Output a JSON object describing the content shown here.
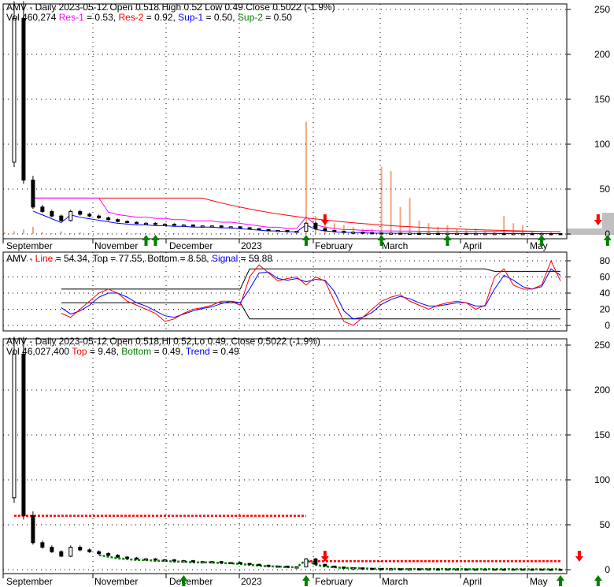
{
  "ticker": "AMV",
  "panel1": {
    "title": "AMV - Daily 2023-05-12 Open 0.518  High 0.52  Low 0.49  Close 0.5022 (-1.9%)",
    "vol": "Vol 460,274 ",
    "res1": "Res-1",
    "res1_val": " = 0.53, ",
    "res2": "Res-2",
    "res2_val": " = 0.92, ",
    "sup1": "Sup-1",
    "sup1_val": " = 0.50, ",
    "sup2": "Sup-2",
    "sup2_val": " = 0.50"
  },
  "panel2": {
    "prefix": "AMV - ",
    "line": "Line",
    "line_val": " = 54.34, Top = 77.55, Bottom = 8.58, ",
    "signal": "Signal",
    "signal_val": " = 59.88"
  },
  "panel3": {
    "title": "AMV - Daily 2023-05-12 Open 0.518,Hi 0.52,Lo 0.49, Close 0.5022 (-1.9%)",
    "vol": "Vol 46,027,400 ",
    "top": "Top",
    "top_val": " = 9.48, ",
    "bottom": "Bottom",
    "bottom_val": " = 0.49, ",
    "trend": "Trend",
    "trend_val": " = 0.49"
  },
  "colors": {
    "res1": "#ff00ff",
    "res2": "#ff0000",
    "sup1": "#0000ff",
    "sup2": "#008000",
    "volume": "#f4a582",
    "up": "#008000",
    "down": "#ff0000"
  },
  "chart_data": [
    {
      "type": "candlestick",
      "title": "AMV - Daily",
      "yticks": [
        0,
        50,
        100,
        150,
        200,
        250
      ],
      "ylim": [
        0,
        260
      ],
      "xlabels": [
        "September",
        "November",
        "December",
        "2023",
        "February",
        "March",
        "April",
        "May"
      ],
      "close": [
        80,
        240,
        60,
        30,
        25,
        20,
        15,
        25,
        22,
        20,
        18,
        16,
        14,
        13,
        12,
        12,
        11,
        11,
        10,
        10,
        9,
        9,
        9,
        8,
        8,
        7,
        6,
        5,
        4,
        4,
        3,
        3,
        12,
        6,
        4,
        3,
        2,
        2,
        1.5,
        1.2,
        1,
        1,
        0.9,
        0.9,
        0.8,
        0.8,
        0.7,
        0.7,
        0.7,
        0.6,
        0.6,
        0.6,
        0.6,
        0.55,
        0.55,
        0.55,
        0.52,
        0.52,
        0.51,
        0.5
      ],
      "volume": [
        2,
        3,
        5,
        8,
        2,
        1,
        3,
        1,
        2,
        1,
        1,
        1,
        0,
        2,
        1,
        1,
        0,
        1,
        1,
        0,
        1,
        1,
        0,
        1,
        1,
        0,
        1,
        1,
        2,
        1,
        3,
        2,
        125,
        20,
        15,
        12,
        10,
        8,
        6,
        6,
        75,
        70,
        30,
        40,
        15,
        12,
        8,
        10,
        6,
        5,
        6,
        4,
        3,
        20,
        12,
        10,
        3,
        2,
        2,
        1
      ],
      "up_signals": [
        15,
        16,
        32,
        40,
        47,
        57,
        64
      ],
      "down_signals": [
        34,
        63
      ]
    },
    {
      "type": "line",
      "yticks": [
        0,
        20,
        40,
        60,
        80
      ],
      "ylim": [
        -5,
        85
      ],
      "series": [
        {
          "name": "Line",
          "values": [
            28,
            28,
            28,
            28,
            35,
            30,
            15,
            10,
            20,
            30,
            40,
            45,
            40,
            30,
            25,
            20,
            15,
            5,
            8,
            15,
            20,
            22,
            25,
            30,
            30,
            25,
            60,
            75,
            65,
            55,
            58,
            60,
            50,
            60,
            55,
            30,
            5,
            0,
            10,
            20,
            30,
            35,
            38,
            30,
            25,
            20,
            25,
            28,
            30,
            28,
            20,
            25,
            60,
            70,
            50,
            45,
            45,
            50,
            80,
            55
          ]
        },
        {
          "name": "Signal",
          "values": [
            28,
            28,
            28,
            28,
            30,
            30,
            22,
            14,
            18,
            25,
            35,
            40,
            40,
            35,
            28,
            24,
            18,
            12,
            10,
            14,
            18,
            21,
            23,
            27,
            30,
            28,
            45,
            65,
            66,
            58,
            56,
            58,
            54,
            57,
            56,
            42,
            18,
            8,
            10,
            16,
            26,
            32,
            36,
            33,
            28,
            24,
            24,
            26,
            28,
            28,
            24,
            24,
            45,
            62,
            56,
            48,
            45,
            48,
            70,
            62
          ]
        }
      ]
    },
    {
      "type": "candlestick",
      "yticks": [
        0,
        50,
        100,
        150,
        200,
        250
      ],
      "ylim": [
        0,
        260
      ],
      "top_levels": [
        {
          "from": 1,
          "to": 32,
          "value": 60
        },
        {
          "from": 32,
          "to": 59,
          "value": 9.48
        }
      ],
      "bottom_value": 0.49,
      "trend_value": 0.49,
      "up_signals": [
        19,
        32,
        59,
        63
      ],
      "down_signals": [
        34,
        61
      ]
    }
  ]
}
